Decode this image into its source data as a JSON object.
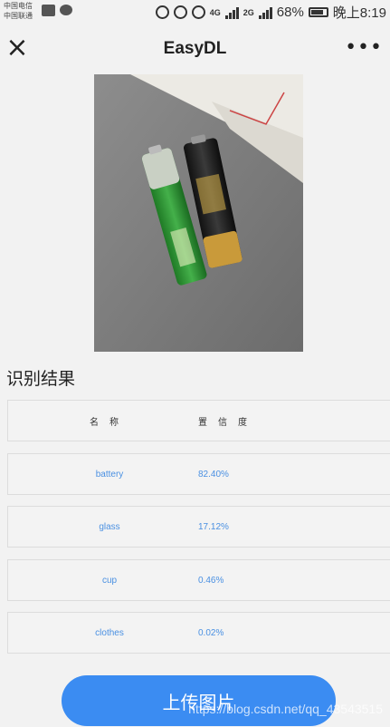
{
  "status_bar": {
    "carrier_1": "中国电信",
    "carrier_2": "中国联通",
    "network_1": "4G",
    "network_2": "2G",
    "battery": "68%",
    "time": "晚上8:19"
  },
  "nav": {
    "title": "EasyDL"
  },
  "results": {
    "section_title": "识别结果",
    "header_name": "名称",
    "header_confidence": "置信度",
    "rows": [
      {
        "name": "battery",
        "confidence": "82.40%"
      },
      {
        "name": "glass",
        "confidence": "17.12%"
      },
      {
        "name": "cup",
        "confidence": "0.46%"
      },
      {
        "name": "clothes",
        "confidence": "0.02%"
      }
    ]
  },
  "upload_button": {
    "label": "上传图片"
  },
  "watermark": "https://blog.csdn.net/qq_43543515",
  "colors": {
    "accent": "#3b8cf2",
    "data_text": "#4a90e2",
    "background": "#f2f2f2"
  }
}
